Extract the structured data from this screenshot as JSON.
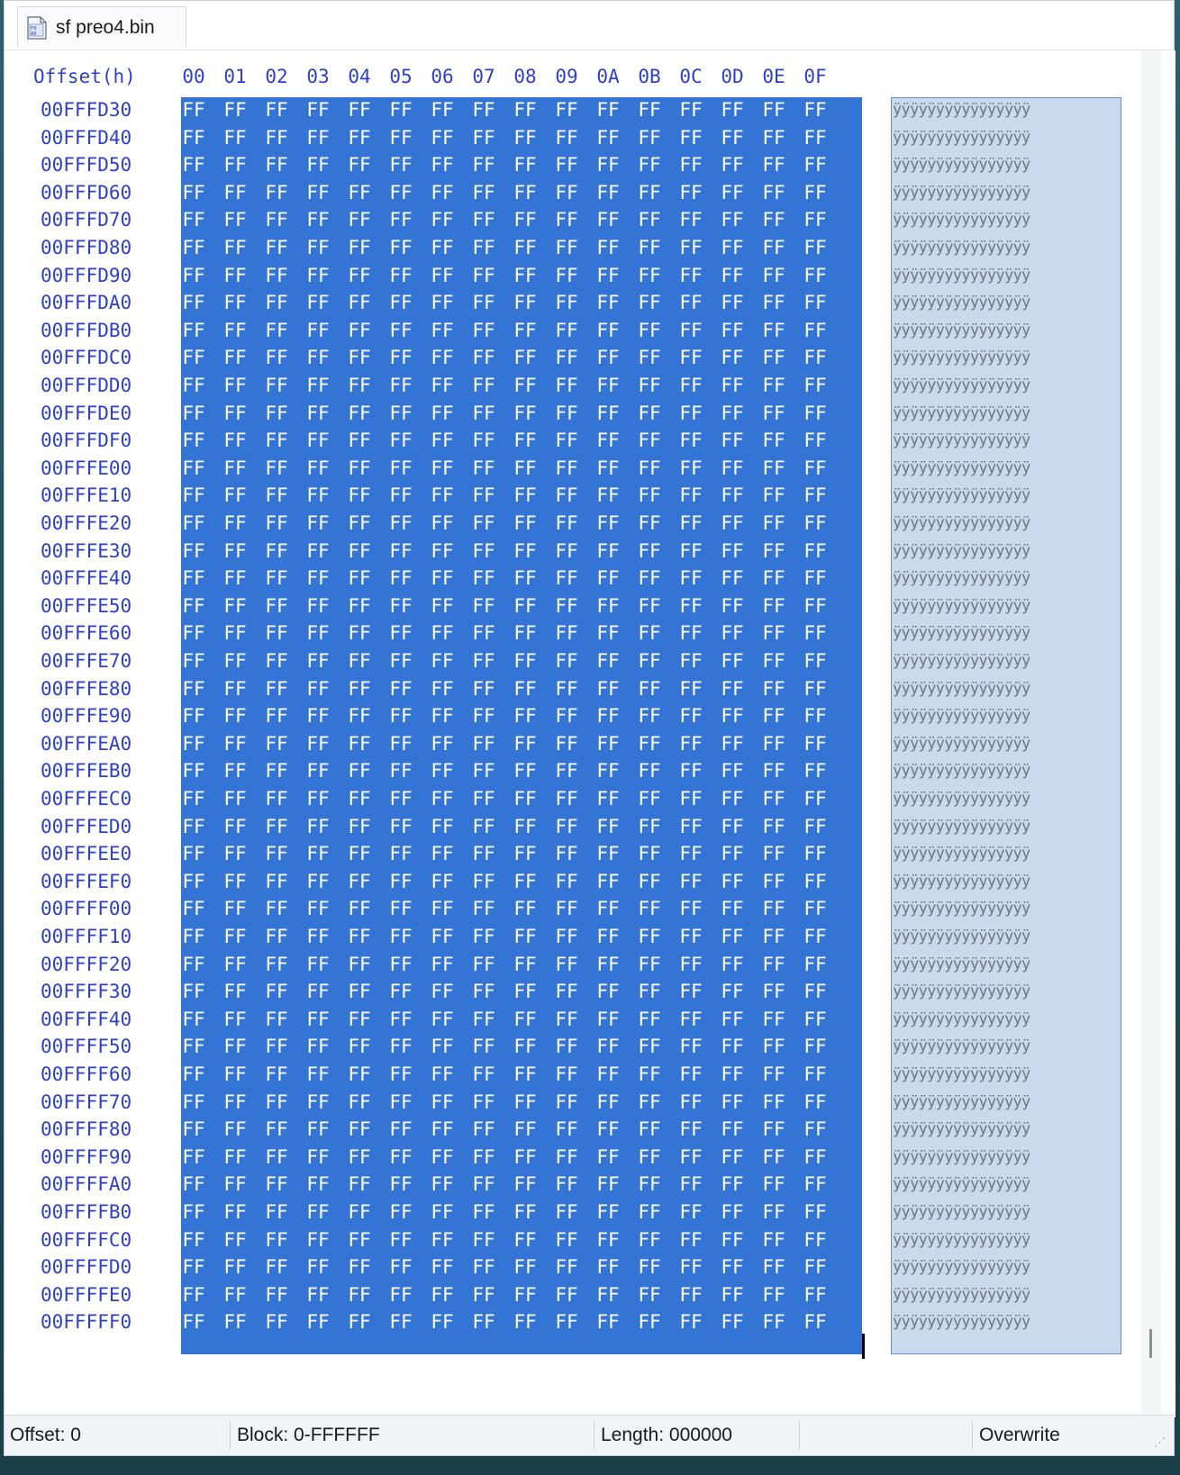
{
  "tab": {
    "label": "sf preo4.bin",
    "icon": "binary-file-icon"
  },
  "header": {
    "offset_label": "Offset(h)",
    "columns": [
      "00",
      "01",
      "02",
      "03",
      "04",
      "05",
      "06",
      "07",
      "08",
      "09",
      "0A",
      "0B",
      "0C",
      "0D",
      "0E",
      "0F"
    ]
  },
  "rows": [
    {
      "offset": "00FFFD30",
      "bytes": [
        "FF",
        "FF",
        "FF",
        "FF",
        "FF",
        "FF",
        "FF",
        "FF",
        "FF",
        "FF",
        "FF",
        "FF",
        "FF",
        "FF",
        "FF",
        "FF"
      ],
      "ascii": "ÿÿÿÿÿÿÿÿÿÿÿÿÿÿÿÿ"
    },
    {
      "offset": "00FFFD40",
      "bytes": [
        "FF",
        "FF",
        "FF",
        "FF",
        "FF",
        "FF",
        "FF",
        "FF",
        "FF",
        "FF",
        "FF",
        "FF",
        "FF",
        "FF",
        "FF",
        "FF"
      ],
      "ascii": "ÿÿÿÿÿÿÿÿÿÿÿÿÿÿÿÿ"
    },
    {
      "offset": "00FFFD50",
      "bytes": [
        "FF",
        "FF",
        "FF",
        "FF",
        "FF",
        "FF",
        "FF",
        "FF",
        "FF",
        "FF",
        "FF",
        "FF",
        "FF",
        "FF",
        "FF",
        "FF"
      ],
      "ascii": "ÿÿÿÿÿÿÿÿÿÿÿÿÿÿÿÿ"
    },
    {
      "offset": "00FFFD60",
      "bytes": [
        "FF",
        "FF",
        "FF",
        "FF",
        "FF",
        "FF",
        "FF",
        "FF",
        "FF",
        "FF",
        "FF",
        "FF",
        "FF",
        "FF",
        "FF",
        "FF"
      ],
      "ascii": "ÿÿÿÿÿÿÿÿÿÿÿÿÿÿÿÿ"
    },
    {
      "offset": "00FFFD70",
      "bytes": [
        "FF",
        "FF",
        "FF",
        "FF",
        "FF",
        "FF",
        "FF",
        "FF",
        "FF",
        "FF",
        "FF",
        "FF",
        "FF",
        "FF",
        "FF",
        "FF"
      ],
      "ascii": "ÿÿÿÿÿÿÿÿÿÿÿÿÿÿÿÿ"
    },
    {
      "offset": "00FFFD80",
      "bytes": [
        "FF",
        "FF",
        "FF",
        "FF",
        "FF",
        "FF",
        "FF",
        "FF",
        "FF",
        "FF",
        "FF",
        "FF",
        "FF",
        "FF",
        "FF",
        "FF"
      ],
      "ascii": "ÿÿÿÿÿÿÿÿÿÿÿÿÿÿÿÿ"
    },
    {
      "offset": "00FFFD90",
      "bytes": [
        "FF",
        "FF",
        "FF",
        "FF",
        "FF",
        "FF",
        "FF",
        "FF",
        "FF",
        "FF",
        "FF",
        "FF",
        "FF",
        "FF",
        "FF",
        "FF"
      ],
      "ascii": "ÿÿÿÿÿÿÿÿÿÿÿÿÿÿÿÿ"
    },
    {
      "offset": "00FFFDA0",
      "bytes": [
        "FF",
        "FF",
        "FF",
        "FF",
        "FF",
        "FF",
        "FF",
        "FF",
        "FF",
        "FF",
        "FF",
        "FF",
        "FF",
        "FF",
        "FF",
        "FF"
      ],
      "ascii": "ÿÿÿÿÿÿÿÿÿÿÿÿÿÿÿÿ"
    },
    {
      "offset": "00FFFDB0",
      "bytes": [
        "FF",
        "FF",
        "FF",
        "FF",
        "FF",
        "FF",
        "FF",
        "FF",
        "FF",
        "FF",
        "FF",
        "FF",
        "FF",
        "FF",
        "FF",
        "FF"
      ],
      "ascii": "ÿÿÿÿÿÿÿÿÿÿÿÿÿÿÿÿ"
    },
    {
      "offset": "00FFFDC0",
      "bytes": [
        "FF",
        "FF",
        "FF",
        "FF",
        "FF",
        "FF",
        "FF",
        "FF",
        "FF",
        "FF",
        "FF",
        "FF",
        "FF",
        "FF",
        "FF",
        "FF"
      ],
      "ascii": "ÿÿÿÿÿÿÿÿÿÿÿÿÿÿÿÿ"
    },
    {
      "offset": "00FFFDD0",
      "bytes": [
        "FF",
        "FF",
        "FF",
        "FF",
        "FF",
        "FF",
        "FF",
        "FF",
        "FF",
        "FF",
        "FF",
        "FF",
        "FF",
        "FF",
        "FF",
        "FF"
      ],
      "ascii": "ÿÿÿÿÿÿÿÿÿÿÿÿÿÿÿÿ"
    },
    {
      "offset": "00FFFDE0",
      "bytes": [
        "FF",
        "FF",
        "FF",
        "FF",
        "FF",
        "FF",
        "FF",
        "FF",
        "FF",
        "FF",
        "FF",
        "FF",
        "FF",
        "FF",
        "FF",
        "FF"
      ],
      "ascii": "ÿÿÿÿÿÿÿÿÿÿÿÿÿÿÿÿ"
    },
    {
      "offset": "00FFFDF0",
      "bytes": [
        "FF",
        "FF",
        "FF",
        "FF",
        "FF",
        "FF",
        "FF",
        "FF",
        "FF",
        "FF",
        "FF",
        "FF",
        "FF",
        "FF",
        "FF",
        "FF"
      ],
      "ascii": "ÿÿÿÿÿÿÿÿÿÿÿÿÿÿÿÿ"
    },
    {
      "offset": "00FFFE00",
      "bytes": [
        "FF",
        "FF",
        "FF",
        "FF",
        "FF",
        "FF",
        "FF",
        "FF",
        "FF",
        "FF",
        "FF",
        "FF",
        "FF",
        "FF",
        "FF",
        "FF"
      ],
      "ascii": "ÿÿÿÿÿÿÿÿÿÿÿÿÿÿÿÿ"
    },
    {
      "offset": "00FFFE10",
      "bytes": [
        "FF",
        "FF",
        "FF",
        "FF",
        "FF",
        "FF",
        "FF",
        "FF",
        "FF",
        "FF",
        "FF",
        "FF",
        "FF",
        "FF",
        "FF",
        "FF"
      ],
      "ascii": "ÿÿÿÿÿÿÿÿÿÿÿÿÿÿÿÿ"
    },
    {
      "offset": "00FFFE20",
      "bytes": [
        "FF",
        "FF",
        "FF",
        "FF",
        "FF",
        "FF",
        "FF",
        "FF",
        "FF",
        "FF",
        "FF",
        "FF",
        "FF",
        "FF",
        "FF",
        "FF"
      ],
      "ascii": "ÿÿÿÿÿÿÿÿÿÿÿÿÿÿÿÿ"
    },
    {
      "offset": "00FFFE30",
      "bytes": [
        "FF",
        "FF",
        "FF",
        "FF",
        "FF",
        "FF",
        "FF",
        "FF",
        "FF",
        "FF",
        "FF",
        "FF",
        "FF",
        "FF",
        "FF",
        "FF"
      ],
      "ascii": "ÿÿÿÿÿÿÿÿÿÿÿÿÿÿÿÿ"
    },
    {
      "offset": "00FFFE40",
      "bytes": [
        "FF",
        "FF",
        "FF",
        "FF",
        "FF",
        "FF",
        "FF",
        "FF",
        "FF",
        "FF",
        "FF",
        "FF",
        "FF",
        "FF",
        "FF",
        "FF"
      ],
      "ascii": "ÿÿÿÿÿÿÿÿÿÿÿÿÿÿÿÿ"
    },
    {
      "offset": "00FFFE50",
      "bytes": [
        "FF",
        "FF",
        "FF",
        "FF",
        "FF",
        "FF",
        "FF",
        "FF",
        "FF",
        "FF",
        "FF",
        "FF",
        "FF",
        "FF",
        "FF",
        "FF"
      ],
      "ascii": "ÿÿÿÿÿÿÿÿÿÿÿÿÿÿÿÿ"
    },
    {
      "offset": "00FFFE60",
      "bytes": [
        "FF",
        "FF",
        "FF",
        "FF",
        "FF",
        "FF",
        "FF",
        "FF",
        "FF",
        "FF",
        "FF",
        "FF",
        "FF",
        "FF",
        "FF",
        "FF"
      ],
      "ascii": "ÿÿÿÿÿÿÿÿÿÿÿÿÿÿÿÿ"
    },
    {
      "offset": "00FFFE70",
      "bytes": [
        "FF",
        "FF",
        "FF",
        "FF",
        "FF",
        "FF",
        "FF",
        "FF",
        "FF",
        "FF",
        "FF",
        "FF",
        "FF",
        "FF",
        "FF",
        "FF"
      ],
      "ascii": "ÿÿÿÿÿÿÿÿÿÿÿÿÿÿÿÿ"
    },
    {
      "offset": "00FFFE80",
      "bytes": [
        "FF",
        "FF",
        "FF",
        "FF",
        "FF",
        "FF",
        "FF",
        "FF",
        "FF",
        "FF",
        "FF",
        "FF",
        "FF",
        "FF",
        "FF",
        "FF"
      ],
      "ascii": "ÿÿÿÿÿÿÿÿÿÿÿÿÿÿÿÿ"
    },
    {
      "offset": "00FFFE90",
      "bytes": [
        "FF",
        "FF",
        "FF",
        "FF",
        "FF",
        "FF",
        "FF",
        "FF",
        "FF",
        "FF",
        "FF",
        "FF",
        "FF",
        "FF",
        "FF",
        "FF"
      ],
      "ascii": "ÿÿÿÿÿÿÿÿÿÿÿÿÿÿÿÿ"
    },
    {
      "offset": "00FFFEA0",
      "bytes": [
        "FF",
        "FF",
        "FF",
        "FF",
        "FF",
        "FF",
        "FF",
        "FF",
        "FF",
        "FF",
        "FF",
        "FF",
        "FF",
        "FF",
        "FF",
        "FF"
      ],
      "ascii": "ÿÿÿÿÿÿÿÿÿÿÿÿÿÿÿÿ"
    },
    {
      "offset": "00FFFEB0",
      "bytes": [
        "FF",
        "FF",
        "FF",
        "FF",
        "FF",
        "FF",
        "FF",
        "FF",
        "FF",
        "FF",
        "FF",
        "FF",
        "FF",
        "FF",
        "FF",
        "FF"
      ],
      "ascii": "ÿÿÿÿÿÿÿÿÿÿÿÿÿÿÿÿ"
    },
    {
      "offset": "00FFFEC0",
      "bytes": [
        "FF",
        "FF",
        "FF",
        "FF",
        "FF",
        "FF",
        "FF",
        "FF",
        "FF",
        "FF",
        "FF",
        "FF",
        "FF",
        "FF",
        "FF",
        "FF"
      ],
      "ascii": "ÿÿÿÿÿÿÿÿÿÿÿÿÿÿÿÿ"
    },
    {
      "offset": "00FFFED0",
      "bytes": [
        "FF",
        "FF",
        "FF",
        "FF",
        "FF",
        "FF",
        "FF",
        "FF",
        "FF",
        "FF",
        "FF",
        "FF",
        "FF",
        "FF",
        "FF",
        "FF"
      ],
      "ascii": "ÿÿÿÿÿÿÿÿÿÿÿÿÿÿÿÿ"
    },
    {
      "offset": "00FFFEE0",
      "bytes": [
        "FF",
        "FF",
        "FF",
        "FF",
        "FF",
        "FF",
        "FF",
        "FF",
        "FF",
        "FF",
        "FF",
        "FF",
        "FF",
        "FF",
        "FF",
        "FF"
      ],
      "ascii": "ÿÿÿÿÿÿÿÿÿÿÿÿÿÿÿÿ"
    },
    {
      "offset": "00FFFEF0",
      "bytes": [
        "FF",
        "FF",
        "FF",
        "FF",
        "FF",
        "FF",
        "FF",
        "FF",
        "FF",
        "FF",
        "FF",
        "FF",
        "FF",
        "FF",
        "FF",
        "FF"
      ],
      "ascii": "ÿÿÿÿÿÿÿÿÿÿÿÿÿÿÿÿ"
    },
    {
      "offset": "00FFFF00",
      "bytes": [
        "FF",
        "FF",
        "FF",
        "FF",
        "FF",
        "FF",
        "FF",
        "FF",
        "FF",
        "FF",
        "FF",
        "FF",
        "FF",
        "FF",
        "FF",
        "FF"
      ],
      "ascii": "ÿÿÿÿÿÿÿÿÿÿÿÿÿÿÿÿ"
    },
    {
      "offset": "00FFFF10",
      "bytes": [
        "FF",
        "FF",
        "FF",
        "FF",
        "FF",
        "FF",
        "FF",
        "FF",
        "FF",
        "FF",
        "FF",
        "FF",
        "FF",
        "FF",
        "FF",
        "FF"
      ],
      "ascii": "ÿÿÿÿÿÿÿÿÿÿÿÿÿÿÿÿ"
    },
    {
      "offset": "00FFFF20",
      "bytes": [
        "FF",
        "FF",
        "FF",
        "FF",
        "FF",
        "FF",
        "FF",
        "FF",
        "FF",
        "FF",
        "FF",
        "FF",
        "FF",
        "FF",
        "FF",
        "FF"
      ],
      "ascii": "ÿÿÿÿÿÿÿÿÿÿÿÿÿÿÿÿ"
    },
    {
      "offset": "00FFFF30",
      "bytes": [
        "FF",
        "FF",
        "FF",
        "FF",
        "FF",
        "FF",
        "FF",
        "FF",
        "FF",
        "FF",
        "FF",
        "FF",
        "FF",
        "FF",
        "FF",
        "FF"
      ],
      "ascii": "ÿÿÿÿÿÿÿÿÿÿÿÿÿÿÿÿ"
    },
    {
      "offset": "00FFFF40",
      "bytes": [
        "FF",
        "FF",
        "FF",
        "FF",
        "FF",
        "FF",
        "FF",
        "FF",
        "FF",
        "FF",
        "FF",
        "FF",
        "FF",
        "FF",
        "FF",
        "FF"
      ],
      "ascii": "ÿÿÿÿÿÿÿÿÿÿÿÿÿÿÿÿ"
    },
    {
      "offset": "00FFFF50",
      "bytes": [
        "FF",
        "FF",
        "FF",
        "FF",
        "FF",
        "FF",
        "FF",
        "FF",
        "FF",
        "FF",
        "FF",
        "FF",
        "FF",
        "FF",
        "FF",
        "FF"
      ],
      "ascii": "ÿÿÿÿÿÿÿÿÿÿÿÿÿÿÿÿ"
    },
    {
      "offset": "00FFFF60",
      "bytes": [
        "FF",
        "FF",
        "FF",
        "FF",
        "FF",
        "FF",
        "FF",
        "FF",
        "FF",
        "FF",
        "FF",
        "FF",
        "FF",
        "FF",
        "FF",
        "FF"
      ],
      "ascii": "ÿÿÿÿÿÿÿÿÿÿÿÿÿÿÿÿ"
    },
    {
      "offset": "00FFFF70",
      "bytes": [
        "FF",
        "FF",
        "FF",
        "FF",
        "FF",
        "FF",
        "FF",
        "FF",
        "FF",
        "FF",
        "FF",
        "FF",
        "FF",
        "FF",
        "FF",
        "FF"
      ],
      "ascii": "ÿÿÿÿÿÿÿÿÿÿÿÿÿÿÿÿ"
    },
    {
      "offset": "00FFFF80",
      "bytes": [
        "FF",
        "FF",
        "FF",
        "FF",
        "FF",
        "FF",
        "FF",
        "FF",
        "FF",
        "FF",
        "FF",
        "FF",
        "FF",
        "FF",
        "FF",
        "FF"
      ],
      "ascii": "ÿÿÿÿÿÿÿÿÿÿÿÿÿÿÿÿ"
    },
    {
      "offset": "00FFFF90",
      "bytes": [
        "FF",
        "FF",
        "FF",
        "FF",
        "FF",
        "FF",
        "FF",
        "FF",
        "FF",
        "FF",
        "FF",
        "FF",
        "FF",
        "FF",
        "FF",
        "FF"
      ],
      "ascii": "ÿÿÿÿÿÿÿÿÿÿÿÿÿÿÿÿ"
    },
    {
      "offset": "00FFFFA0",
      "bytes": [
        "FF",
        "FF",
        "FF",
        "FF",
        "FF",
        "FF",
        "FF",
        "FF",
        "FF",
        "FF",
        "FF",
        "FF",
        "FF",
        "FF",
        "FF",
        "FF"
      ],
      "ascii": "ÿÿÿÿÿÿÿÿÿÿÿÿÿÿÿÿ"
    },
    {
      "offset": "00FFFFB0",
      "bytes": [
        "FF",
        "FF",
        "FF",
        "FF",
        "FF",
        "FF",
        "FF",
        "FF",
        "FF",
        "FF",
        "FF",
        "FF",
        "FF",
        "FF",
        "FF",
        "FF"
      ],
      "ascii": "ÿÿÿÿÿÿÿÿÿÿÿÿÿÿÿÿ"
    },
    {
      "offset": "00FFFFC0",
      "bytes": [
        "FF",
        "FF",
        "FF",
        "FF",
        "FF",
        "FF",
        "FF",
        "FF",
        "FF",
        "FF",
        "FF",
        "FF",
        "FF",
        "FF",
        "FF",
        "FF"
      ],
      "ascii": "ÿÿÿÿÿÿÿÿÿÿÿÿÿÿÿÿ"
    },
    {
      "offset": "00FFFFD0",
      "bytes": [
        "FF",
        "FF",
        "FF",
        "FF",
        "FF",
        "FF",
        "FF",
        "FF",
        "FF",
        "FF",
        "FF",
        "FF",
        "FF",
        "FF",
        "FF",
        "FF"
      ],
      "ascii": "ÿÿÿÿÿÿÿÿÿÿÿÿÿÿÿÿ"
    },
    {
      "offset": "00FFFFE0",
      "bytes": [
        "FF",
        "FF",
        "FF",
        "FF",
        "FF",
        "FF",
        "FF",
        "FF",
        "FF",
        "FF",
        "FF",
        "FF",
        "FF",
        "FF",
        "FF",
        "FF"
      ],
      "ascii": "ÿÿÿÿÿÿÿÿÿÿÿÿÿÿÿÿ"
    },
    {
      "offset": "00FFFFF0",
      "bytes": [
        "FF",
        "FF",
        "FF",
        "FF",
        "FF",
        "FF",
        "FF",
        "FF",
        "FF",
        "FF",
        "FF",
        "FF",
        "FF",
        "FF",
        "FF",
        "FF"
      ],
      "ascii": "ÿÿÿÿÿÿÿÿÿÿÿÿÿÿÿÿ"
    }
  ],
  "status": {
    "offset": "Offset: 0",
    "block": "Block: 0-FFFFFF",
    "length": "Length: 000000",
    "mode": "Overwrite"
  },
  "colors": {
    "selection": "#3474d4",
    "ascii_selection": "#c9d9ee",
    "offset_text": "#2d41c8"
  }
}
